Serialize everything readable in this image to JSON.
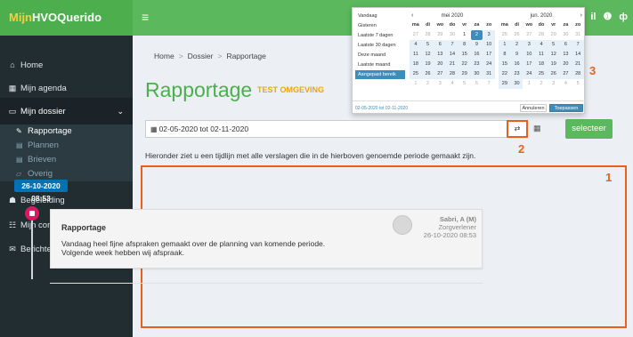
{
  "brand": {
    "part1": "Mijn",
    "part2": "HVOQuerido"
  },
  "topbar": {
    "menu_icon": "hamburger-icon",
    "icon_glyph": "≡",
    "user_initial": "il",
    "info_glyph": "❶",
    "extra_glyph": "ф"
  },
  "sidebar": {
    "items": [
      {
        "label": "Home",
        "icon": "home-icon",
        "glyph": "⌂"
      },
      {
        "label": "Mijn agenda",
        "icon": "calendar-icon",
        "glyph": "▦"
      },
      {
        "label": "Mijn dossier",
        "icon": "folder-open-icon",
        "glyph": "▭",
        "caret": "⌄"
      },
      {
        "label": "Begeleiding",
        "icon": "users-icon",
        "glyph": "☗"
      },
      {
        "label": "Mijn contacten",
        "icon": "contacts-icon",
        "glyph": "☷"
      },
      {
        "label": "Berichten",
        "icon": "envelope-icon",
        "glyph": "✉",
        "caret": "‹"
      }
    ],
    "subitems": [
      {
        "label": "Rapportage",
        "icon": "edit-icon",
        "glyph": "✎"
      },
      {
        "label": "Plannen",
        "icon": "file-icon",
        "glyph": "▤"
      },
      {
        "label": "Brieven",
        "icon": "file-icon",
        "glyph": "▤"
      },
      {
        "label": "Overig",
        "icon": "folder-icon",
        "glyph": "▱"
      }
    ]
  },
  "breadcrumb": [
    "Home",
    "Dossier",
    "Rapportage"
  ],
  "breadcrumb_sep": ">",
  "page": {
    "title": "Rapportage",
    "env": "TEST OMGEVING"
  },
  "filter": {
    "date_range": "02-05-2020 tot 02-11-2020",
    "cal_glyph": "▦",
    "arrow_glyph": "⇄",
    "select_label": "selecteer"
  },
  "info_text": "Hieronder ziet u een tijdlijn met alle verslagen die in de hierboven genoemde periode gemaakt zijn.",
  "timeline": {
    "date": "26-10-2020 08:53",
    "entry": {
      "title": "Rapportage",
      "line1": "Vandaag heel fijne afspraken gemaakt over de planning van komende periode.",
      "line2": "Volgende week hebben wij afspraak.",
      "author": "Sabri, A (M)",
      "role": "Zorgverlener",
      "timestamp": "26-10-2020 08:53"
    }
  },
  "annotations": [
    "1",
    "2",
    "3"
  ],
  "picker": {
    "ranges": [
      "Vandaag",
      "Gisteren",
      "Laatste 7 dagen",
      "Laatste 30 dagen",
      "Deze maand",
      "Laatste maand",
      "Aangepast bereik"
    ],
    "selected_range": "Aangepast bereik",
    "prev_glyph": "‹",
    "next_glyph": "›",
    "left": {
      "month": "mei 2020",
      "days": [
        "27",
        "28",
        "29",
        "30",
        "1",
        "2",
        "3",
        "4",
        "5",
        "6",
        "7",
        "8",
        "9",
        "10",
        "11",
        "12",
        "13",
        "14",
        "15",
        "16",
        "17",
        "18",
        "19",
        "20",
        "21",
        "22",
        "23",
        "24",
        "25",
        "26",
        "27",
        "28",
        "29",
        "30",
        "31",
        "1",
        "2",
        "3",
        "4",
        "5",
        "6",
        "7"
      ]
    },
    "right": {
      "month": "jun. 2020",
      "days": [
        "25",
        "26",
        "27",
        "28",
        "29",
        "30",
        "31",
        "1",
        "2",
        "3",
        "4",
        "5",
        "6",
        "7",
        "8",
        "9",
        "10",
        "11",
        "12",
        "13",
        "14",
        "15",
        "16",
        "17",
        "18",
        "19",
        "20",
        "21",
        "22",
        "23",
        "24",
        "25",
        "26",
        "27",
        "28",
        "29",
        "30",
        "1",
        "2",
        "3",
        "4",
        "5"
      ]
    },
    "weekdays": [
      "ma",
      "di",
      "wo",
      "do",
      "vr",
      "za",
      "zo"
    ],
    "footer_range": "02-05-2020 tot 02-11-2020",
    "cancel_label": "Annuleren",
    "apply_label": "Toepassen"
  },
  "colors": {
    "sidebar": "#222d32",
    "brand": "#4cae4c",
    "topbar": "#5cb85c",
    "accent": "#3c8dbc",
    "annotation": "#e8601c"
  }
}
